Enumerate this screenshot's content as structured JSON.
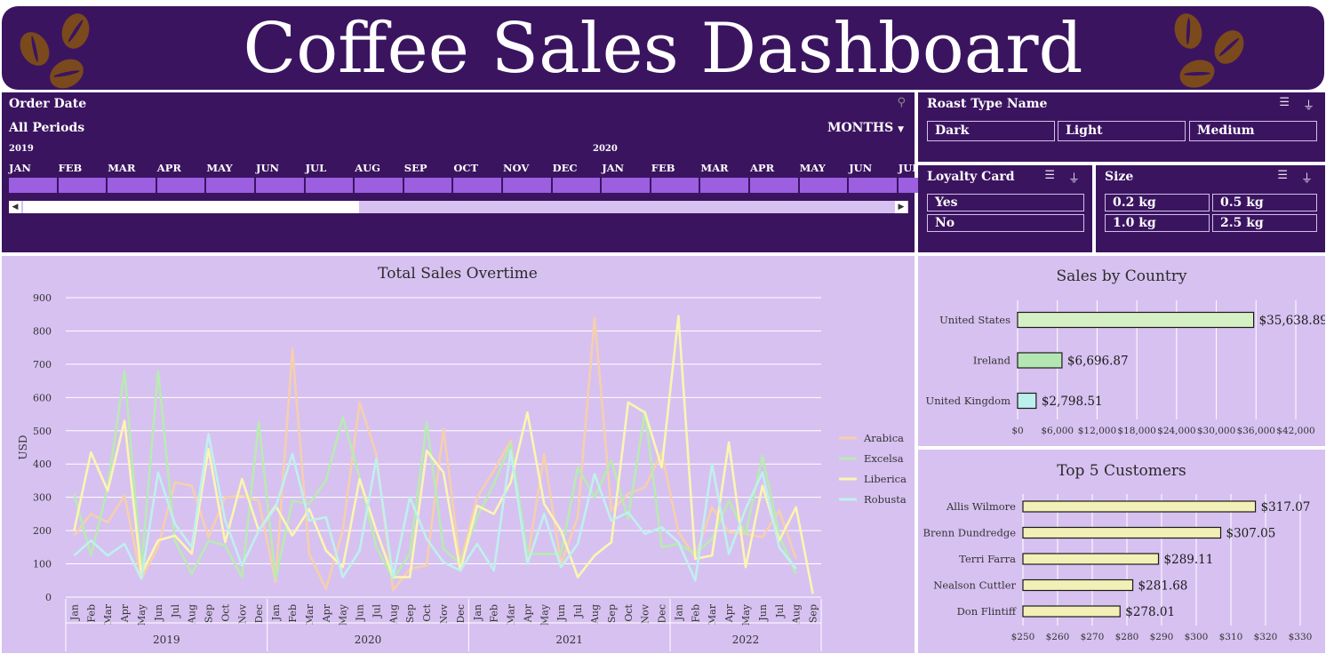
{
  "header": {
    "title": "Coffee Sales Dashboard"
  },
  "timeline": {
    "title": "Order Date",
    "period": "All Periods",
    "granularity": "MONTHS",
    "year_2019": "2019",
    "year_2020": "2020",
    "months": [
      "JAN",
      "FEB",
      "MAR",
      "APR",
      "MAY",
      "JUN",
      "JUL",
      "AUG",
      "SEP",
      "OCT",
      "NOV",
      "DEC",
      "JAN",
      "FEB",
      "MAR",
      "APR",
      "MAY",
      "JUN",
      "JUL"
    ]
  },
  "slicers": {
    "roast": {
      "title": "Roast Type Name",
      "options": [
        "Dark",
        "Light",
        "Medium"
      ]
    },
    "loyalty": {
      "title": "Loyalty Card",
      "options": [
        "Yes",
        "No"
      ]
    },
    "size": {
      "title": "Size",
      "options": [
        "0.2 kg",
        "0.5 kg",
        "1.0 kg",
        "2.5 kg"
      ]
    }
  },
  "colors": {
    "panel_dark": "#3b1460",
    "panel_light": "#d7c1f0",
    "timeline_cell": "#9b5fe0"
  },
  "chart_data": [
    {
      "type": "line",
      "title": "Total Sales Overtime",
      "ylabel": "USD",
      "ylim": [
        0,
        900
      ],
      "yticks": [
        0,
        100,
        200,
        300,
        400,
        500,
        600,
        700,
        800,
        900
      ],
      "grid": true,
      "legend": "right",
      "month_labels": [
        "Jan",
        "Feb",
        "Mar",
        "Apr",
        "May",
        "Jun",
        "Jul",
        "Aug",
        "Sep",
        "Oct",
        "Nov",
        "Dec"
      ],
      "years": [
        "2019",
        "2020",
        "2021",
        "2022"
      ],
      "series": [
        {
          "name": "Arabica",
          "color": "#f5cfae",
          "values": [
            185,
            250,
            225,
            305,
            55,
            150,
            345,
            335,
            180,
            300,
            305,
            290,
            45,
            745,
            130,
            25,
            200,
            585,
            430,
            20,
            85,
            95,
            505,
            100,
            300,
            380,
            470,
            110,
            430,
            100,
            240,
            840,
            260,
            310,
            330,
            435,
            195,
            120,
            270,
            195,
            190,
            180,
            260,
            115
          ]
        },
        {
          "name": "Excelsa",
          "color": "#b8eab2",
          "values": [
            310,
            125,
            330,
            680,
            85,
            680,
            170,
            70,
            170,
            155,
            60,
            525,
            55,
            290,
            280,
            350,
            540,
            360,
            150,
            55,
            130,
            525,
            145,
            100,
            240,
            340,
            460,
            130,
            130,
            130,
            390,
            300,
            410,
            235,
            560,
            150,
            160,
            130,
            175,
            290,
            190,
            425,
            185,
            70
          ]
        },
        {
          "name": "Liberica",
          "color": "#fbf5b2",
          "values": [
            200,
            435,
            320,
            530,
            70,
            170,
            185,
            130,
            445,
            165,
            355,
            200,
            275,
            185,
            265,
            140,
            90,
            355,
            200,
            60,
            60,
            440,
            375,
            80,
            275,
            250,
            345,
            555,
            280,
            200,
            60,
            125,
            165,
            585,
            555,
            390,
            845,
            115,
            125,
            465,
            90,
            335,
            170,
            270,
            10
          ]
        },
        {
          "name": "Robusta",
          "color": "#bff0ee",
          "values": [
            125,
            170,
            125,
            160,
            55,
            375,
            220,
            150,
            490,
            230,
            95,
            200,
            270,
            430,
            230,
            240,
            60,
            140,
            415,
            60,
            300,
            175,
            105,
            80,
            160,
            80,
            440,
            100,
            250,
            90,
            160,
            370,
            230,
            255,
            190,
            210,
            165,
            50,
            400,
            130,
            265,
            375,
            150,
            85
          ]
        }
      ]
    },
    {
      "type": "bar",
      "title": "Sales by Country",
      "categories": [
        "United States",
        "Ireland",
        "United Kingdom"
      ],
      "values": [
        35638.89,
        6696.87,
        2798.51
      ],
      "value_labels": [
        "$35,638.89",
        "$6,696.87",
        "$2,798.51"
      ],
      "colors": [
        "#d6f0c6",
        "#b4e6b4",
        "#bcf0ec"
      ],
      "xlim": [
        0,
        42000
      ],
      "xtick_labels": [
        "$0",
        "$6,000",
        "$12,000",
        "$18,000",
        "$24,000",
        "$30,000",
        "$36,000",
        "$42,000"
      ]
    },
    {
      "type": "bar",
      "title": "Top 5 Customers",
      "categories": [
        "Allis Wilmore",
        "Brenn Dundredge",
        "Terri Farra",
        "Nealson Cuttler",
        "Don Flintiff"
      ],
      "values": [
        317.07,
        307.05,
        289.11,
        281.68,
        278.01
      ],
      "value_labels": [
        "$317.07",
        "$307.05",
        "$289.11",
        "$281.68",
        "$278.01"
      ],
      "color": "#f2f0b6",
      "xlim": [
        250,
        330
      ],
      "xtick_labels": [
        "$250",
        "$260",
        "$270",
        "$280",
        "$290",
        "$300",
        "$310",
        "$320",
        "$330"
      ]
    }
  ]
}
